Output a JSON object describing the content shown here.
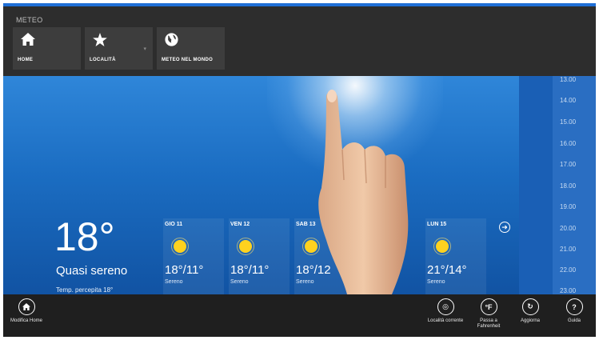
{
  "app": {
    "title": "METEO"
  },
  "nav": {
    "tiles": [
      {
        "label": "HOME",
        "icon": "home-icon"
      },
      {
        "label": "LOCALITÀ",
        "icon": "star-icon"
      },
      {
        "label": "METEO NEL MONDO",
        "icon": "globe-icon"
      }
    ],
    "chevron": "▾"
  },
  "current": {
    "temp": "18°",
    "condition": "Quasi sereno",
    "feels_like": "Temp. percepita 18°"
  },
  "forecast": [
    {
      "day": "GIO 11",
      "temp": "18°/11°",
      "cond": "Sereno"
    },
    {
      "day": "VEN 12",
      "temp": "18°/11°",
      "cond": "Sereno"
    },
    {
      "day": "SAB 13",
      "temp": "18°/12",
      "cond": "Sereno"
    },
    {
      "day": "LUN 15",
      "temp": "21°/14°",
      "cond": "Sereno"
    }
  ],
  "next_icon": "arrow-right-icon",
  "hourly": [
    "13.00",
    "14.00",
    "15.00",
    "16.00",
    "17.00",
    "18.00",
    "19.00",
    "20.00",
    "21.00",
    "22.00",
    "23.00"
  ],
  "appbar": {
    "left": {
      "label": "Modifica Home",
      "icon": "home-edit-icon"
    },
    "right": [
      {
        "label": "Località corrente",
        "icon": "locate-icon",
        "glyph": "◎"
      },
      {
        "label": "Passa a Fahrenheit",
        "icon": "fahrenheit-icon",
        "glyph": "°F"
      },
      {
        "label": "Aggiorna",
        "icon": "refresh-icon",
        "glyph": "↻"
      },
      {
        "label": "Guida",
        "icon": "help-icon",
        "glyph": "?"
      }
    ]
  },
  "colors": {
    "accent": "#1f6fd6",
    "appbar": "#1f1f1f",
    "navbar": "#2d2d2d",
    "sky": "#1b6dc2"
  }
}
